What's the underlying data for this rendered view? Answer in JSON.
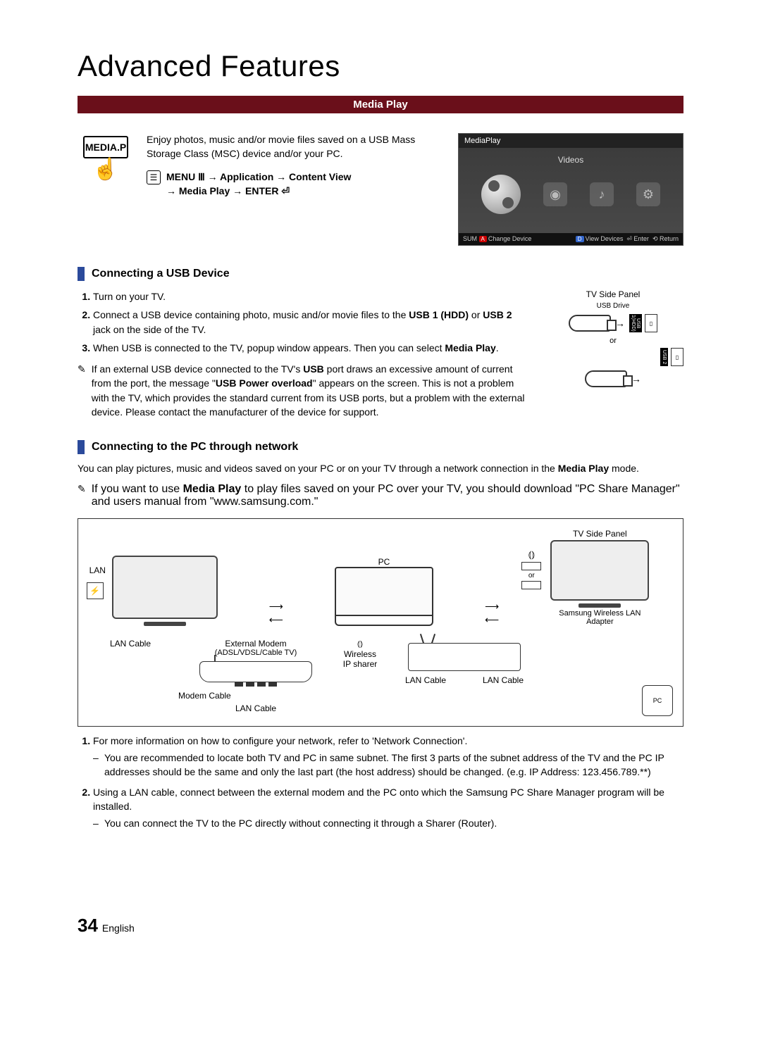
{
  "title": "Advanced Features",
  "banner": "Media Play",
  "remote_label": "MEDIA.P",
  "intro": "Enjoy photos, music and/or movie files saved on a USB Mass Storage Class (MSC) device and/or your PC.",
  "nav_line1": "MENU Ⅲ → Application → Content View",
  "nav_line2": "→ Media Play → ENTER ⏎",
  "screenshot": {
    "header": "MediaPlay",
    "mode": "Videos",
    "footer_left_badge": "A",
    "footer_left": "Change Device",
    "footer_right_badge": "D",
    "footer_right1": "View Devices",
    "footer_right2": "Enter",
    "footer_right3": "Return",
    "sum": "SUM"
  },
  "section1_title": "Connecting a USB Device",
  "steps1": {
    "s1": "Turn on your TV.",
    "s2": "Connect a USB device containing photo, music and/or movie files to the USB 1 (HDD) or USB 2 jack on the side of the TV.",
    "s3": "When USB is connected to the TV, popup window appears. Then you can select Media Play."
  },
  "side_panel": {
    "title": "TV Side Panel",
    "drive": "USB Drive",
    "port1": "USB 1(HDD)",
    "port2": "USB 2",
    "or": "or"
  },
  "note1": "If an external USB device connected to the TV's USB port draws an excessive amount of current from the port, the message \"USB Power overload\" appears on the screen. This is not a problem with the TV, which provides the standard current from its USB ports, but a problem with the external device. Please contact the manufacturer of the device for support.",
  "section2_title": "Connecting to the PC through network",
  "para2": "You can play pictures, music and videos saved on your PC or on your TV through a network connection in the Media Play mode.",
  "note2": "If you want to use Media Play to play files saved on your PC over your TV, you should download \"PC Share Manager\" and users manual from \"www.samsung.com.\"",
  "diagram": {
    "lan": "LAN",
    "pc": "PC",
    "side_title": "TV Side Panel",
    "or": "or",
    "samsung": "Samsung Wireless LAN Adapter",
    "external_modem": "External Modem",
    "external_modem_sub": "(ADSL/VDSL/Cable TV)",
    "lan_cable": "LAN Cable",
    "modem_cable": "Modem Cable",
    "wireless_ip": "Wireless IP sharer"
  },
  "steps2": {
    "s1": "For more information on how to configure your network, refer to 'Network Connection'.",
    "s1a": "You are recommended to locate both TV and PC in same subnet. The first 3 parts of the subnet address of the TV and the PC IP addresses should be the same and only the last part (the host address) should be changed. (e.g. IP Address: 123.456.789.**)",
    "s2": "Using a LAN cable, connect between the external modem and the PC onto which the Samsung PC Share Manager program will be installed.",
    "s2a": "You can connect the TV to the PC directly without connecting it through a Sharer (Router)."
  },
  "footer": {
    "num": "34",
    "lang": "English"
  }
}
